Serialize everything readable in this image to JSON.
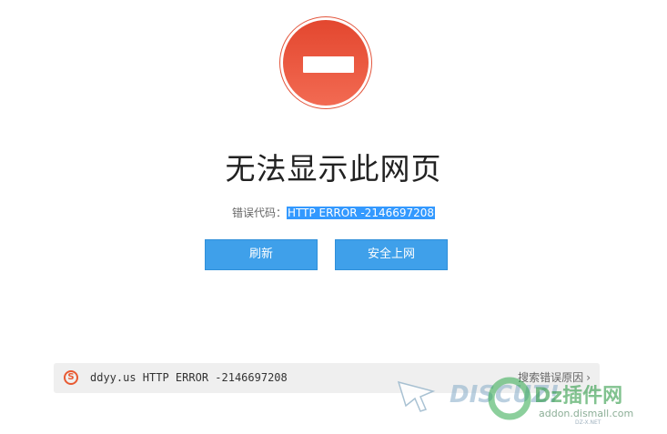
{
  "page": {
    "title": "无法显示此网页",
    "error_label": "错误代码：",
    "error_code": "HTTP ERROR -2146697208"
  },
  "buttons": {
    "refresh": "刷新",
    "safe_browse": "安全上网"
  },
  "bottom_bar": {
    "icon_letter": "S",
    "message": "ddyy.us HTTP ERROR -2146697208",
    "search_link": "搜索错误原因",
    "chevron": "›"
  },
  "watermark": {
    "brand": "DISCUZ!",
    "site_name": "Dz插件网",
    "url": "addon.dismall.com",
    "sub": "DZ-X.NET"
  },
  "colors": {
    "stop_icon": "#e84a31",
    "button": "#3fa0ea",
    "highlight": "#3399ff",
    "bottom_bar_bg": "#efefef"
  }
}
